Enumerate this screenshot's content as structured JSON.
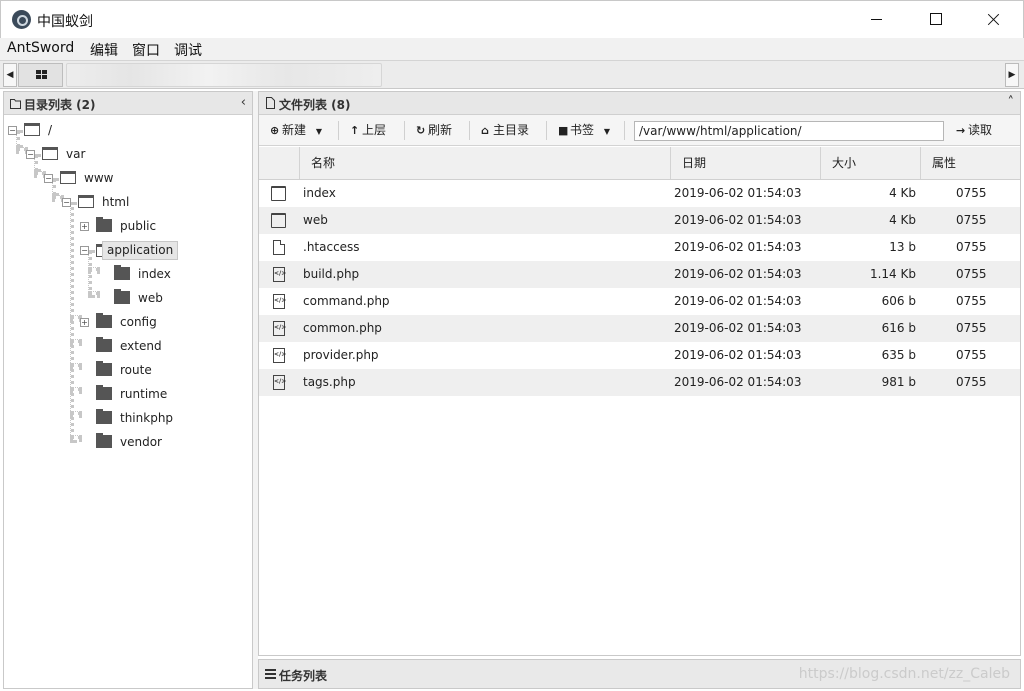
{
  "window": {
    "title": "中国蚁剑"
  },
  "menu": [
    "AntSword",
    "编辑",
    "窗口",
    "调试"
  ],
  "dir_panel": {
    "title": "目录列表 (2)"
  },
  "tree": {
    "root": "/",
    "var": "var",
    "www": "www",
    "html": "html",
    "public": "public",
    "application": "application",
    "app_index": "index",
    "app_web": "web",
    "config": "config",
    "extend": "extend",
    "route": "route",
    "runtime": "runtime",
    "thinkphp": "thinkphp",
    "vendor": "vendor"
  },
  "file_panel": {
    "title": "文件列表 (8)"
  },
  "toolbar": {
    "new_label": "新建",
    "up_label": "上层",
    "refresh_label": "刷新",
    "home_label": "主目录",
    "bookmark_label": "书签",
    "path_value": "/var/www/html/application/",
    "read_label": "读取"
  },
  "columns": {
    "name": "名称",
    "date": "日期",
    "size": "大小",
    "attr": "属性"
  },
  "files": [
    {
      "icon": "folder-icon",
      "name": "index",
      "date": "2019-06-02 01:54:03",
      "size": "4 Kb",
      "attr": "0755"
    },
    {
      "icon": "folder-icon",
      "name": "web",
      "date": "2019-06-02 01:54:03",
      "size": "4 Kb",
      "attr": "0755"
    },
    {
      "icon": "file-icon",
      "name": ".htaccess",
      "date": "2019-06-02 01:54:03",
      "size": "13 b",
      "attr": "0755"
    },
    {
      "icon": "code-file-icon",
      "name": "build.php",
      "date": "2019-06-02 01:54:03",
      "size": "1.14 Kb",
      "attr": "0755"
    },
    {
      "icon": "code-file-icon",
      "name": "command.php",
      "date": "2019-06-02 01:54:03",
      "size": "606 b",
      "attr": "0755"
    },
    {
      "icon": "code-file-icon",
      "name": "common.php",
      "date": "2019-06-02 01:54:03",
      "size": "616 b",
      "attr": "0755"
    },
    {
      "icon": "code-file-icon",
      "name": "provider.php",
      "date": "2019-06-02 01:54:03",
      "size": "635 b",
      "attr": "0755"
    },
    {
      "icon": "code-file-icon",
      "name": "tags.php",
      "date": "2019-06-02 01:54:03",
      "size": "981 b",
      "attr": "0755"
    }
  ],
  "task_panel": {
    "title": "任务列表"
  },
  "watermark": "https://blog.csdn.net/zz_Caleb"
}
